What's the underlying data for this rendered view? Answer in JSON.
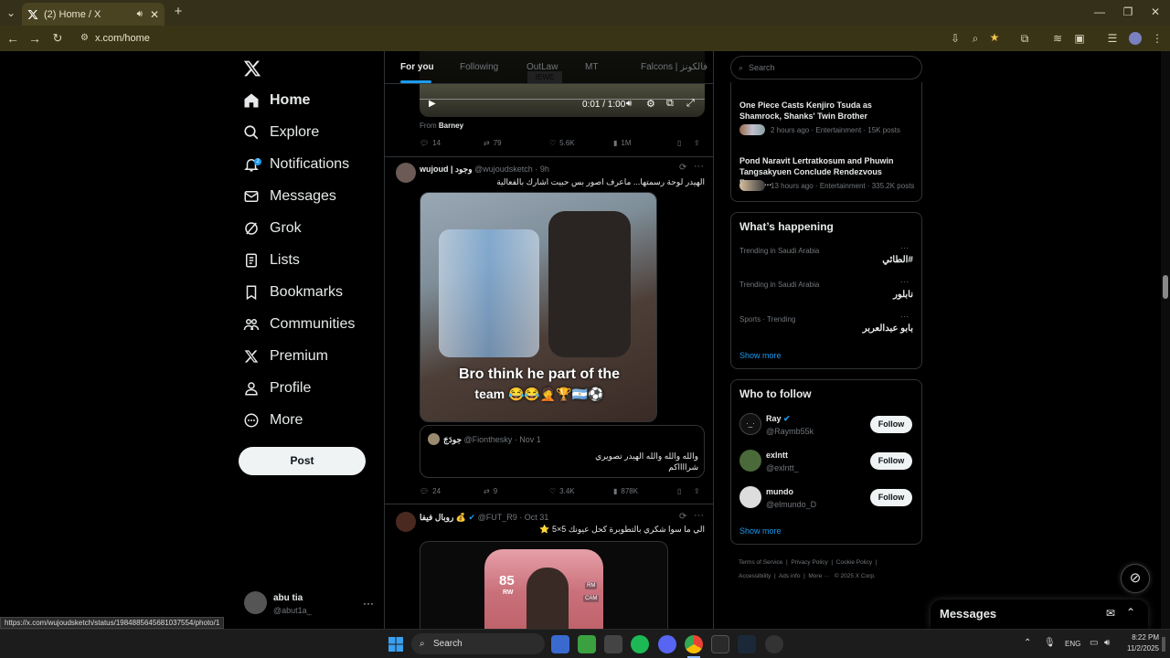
{
  "browser": {
    "tab_title": "(2) Home / X",
    "url": "x.com/home",
    "status_url": "https://x.com/wujoudsketch/status/1984885645681037554/photo/1"
  },
  "nav": {
    "items": [
      {
        "label": "Home",
        "icon": "home-icon"
      },
      {
        "label": "Explore",
        "icon": "search-icon"
      },
      {
        "label": "Notifications",
        "icon": "bell-icon"
      },
      {
        "label": "Messages",
        "icon": "envelope-icon"
      },
      {
        "label": "Grok",
        "icon": "grok-icon"
      },
      {
        "label": "Lists",
        "icon": "list-icon"
      },
      {
        "label": "Bookmarks",
        "icon": "bookmark-icon"
      },
      {
        "label": "Communities",
        "icon": "people-icon"
      },
      {
        "label": "Premium",
        "icon": "x-logo-icon"
      },
      {
        "label": "Profile",
        "icon": "person-icon"
      },
      {
        "label": "More",
        "icon": "more-circle-icon"
      }
    ],
    "notification_badge": "2",
    "post_label": "Post",
    "account": {
      "name": "abu tia",
      "handle": "@abut1a_"
    }
  },
  "timeline": {
    "tabs": [
      "For you",
      "Following",
      "OutLaw",
      "MT",
      "Falcons | فالكونز"
    ],
    "video": {
      "time": "0:01 / 1:00"
    },
    "from_label": "From",
    "from_name": "Barney",
    "post1_actions": {
      "replies": "14",
      "reposts": "79",
      "likes": "5.6K",
      "views": "1M"
    },
    "post2": {
      "name": "wujoud | وجود",
      "handle": "@wujoudsketch",
      "time": "9h",
      "text": "الهيدر لوحة رسمتها... ماعرف اصور بس حبيت اشارك بالفعالية",
      "image_caption_line1": "Bro think he part of the",
      "image_caption_line2": "team 😂😂🤦🏆🇦🇷⚽",
      "quote": {
        "name": "جودَجَ",
        "handle": "@Fionthesky",
        "time": "Nov 1",
        "line1": "والله والله والله الهيدر تصويري",
        "line2": "شرااااكم"
      },
      "actions": {
        "replies": "24",
        "reposts": "9",
        "likes": "3.4K",
        "views": "878K"
      }
    },
    "post3": {
      "name": "روبال فيفا 💰",
      "handle": "@FUT_R9",
      "time": "Oct 31",
      "text": "الي ما سوا شكري بالتطوبرة كحل عيونك 5×5 ⭐",
      "card_rating": "85",
      "card_pos": "RW",
      "card_badge1": "RM",
      "card_badge2": "CAM"
    }
  },
  "sidebar": {
    "search_placeholder": "Search",
    "news": [
      {
        "title": "One Piece Casts Kenjiro Tsuda as Shamrock, Shanks' Twin Brother",
        "meta": "2 hours ago · Entertainment · 15K posts"
      },
      {
        "title": "Pond Naravit Lertratkosum and Phuwin Tangsakyuen Conclude Rendezvous Fanco…",
        "meta": "13 hours ago · Entertainment · 335.2K posts"
      }
    ],
    "happening_title": "What’s happening",
    "trends": [
      {
        "context": "Trending in Saudi Arabia",
        "name": "#الطائي"
      },
      {
        "context": "Trending in Saudi Arabia",
        "name": "نابلور"
      },
      {
        "context": "Sports · Trending",
        "name": "بابو عبدالعربر"
      }
    ],
    "show_more": "Show more",
    "follow_title": "Who to follow",
    "follow": [
      {
        "name": "Ray",
        "handle": "@Raymb55k",
        "button": "Follow"
      },
      {
        "name": "exlntt",
        "handle": "@exlntt_",
        "button": "Follow"
      },
      {
        "name": "mundo",
        "handle": "@elmundo_D",
        "button": "Follow"
      }
    ],
    "show_more2": "Show more",
    "footer": [
      "Terms of Service",
      "Privacy Policy",
      "Cookie Policy",
      "Accessibility",
      "Ads info",
      "More ···",
      "© 2025 X Corp."
    ],
    "messages_label": "Messages"
  },
  "taskbar": {
    "search_label": "Search",
    "lang": "ENG",
    "time": "8:22 PM",
    "date": "11/2/2025"
  },
  "colors": {
    "accent": "#1d9bf0",
    "chrome": "#3a3417",
    "background": "#000000"
  }
}
